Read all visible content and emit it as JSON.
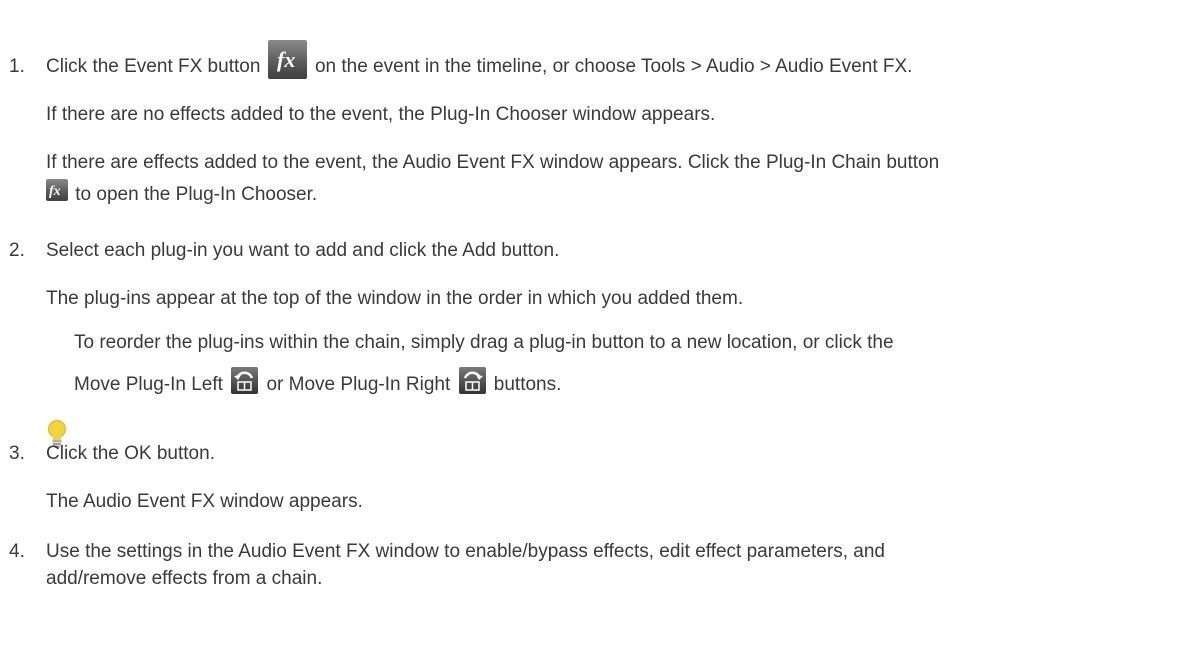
{
  "steps": [
    {
      "number": "1.",
      "text_before_icon": "Click the Event FX button",
      "text_after_icon": "on the event in the timeline, or choose Tools > Audio > Audio Event FX.",
      "para_no_effects": "If there are no effects added to the event, the Plug-In Chooser window appears.",
      "para_effects_line1": "If there are effects added to the event, the Audio Event FX window appears. Click the Plug-In Chain button",
      "para_effects_line2": "to open the Plug-In Chooser."
    },
    {
      "number": "2.",
      "text": "Select each plug-in you want to add and click the Add button.",
      "para": "The plug-ins appear at the top of the window in the order in which you added them.",
      "tip_line1": "To reorder the plug-ins within the chain, simply drag a plug-in button to a new location, or click the",
      "tip_move_left": "Move Plug-In Left",
      "tip_or": "or Move Plug-In Right",
      "tip_buttons": "buttons."
    },
    {
      "number": "3.",
      "text": "Click the OK button.",
      "para": "The Audio Event FX window appears."
    },
    {
      "number": "4.",
      "text_line1": "Use the settings in the Audio Event FX window to enable/bypass effects, edit effect parameters, and",
      "text_line2": "add/remove effects from a chain."
    }
  ],
  "icons": {
    "fx": "fx-icon",
    "move_left": "move-plugin-left-icon",
    "move_right": "move-plugin-right-icon",
    "tip": "lightbulb-icon"
  },
  "colors": {
    "text": "#3a3a3a",
    "icon_bg": "#5c5c5c",
    "bulb": "#f2d33a"
  }
}
